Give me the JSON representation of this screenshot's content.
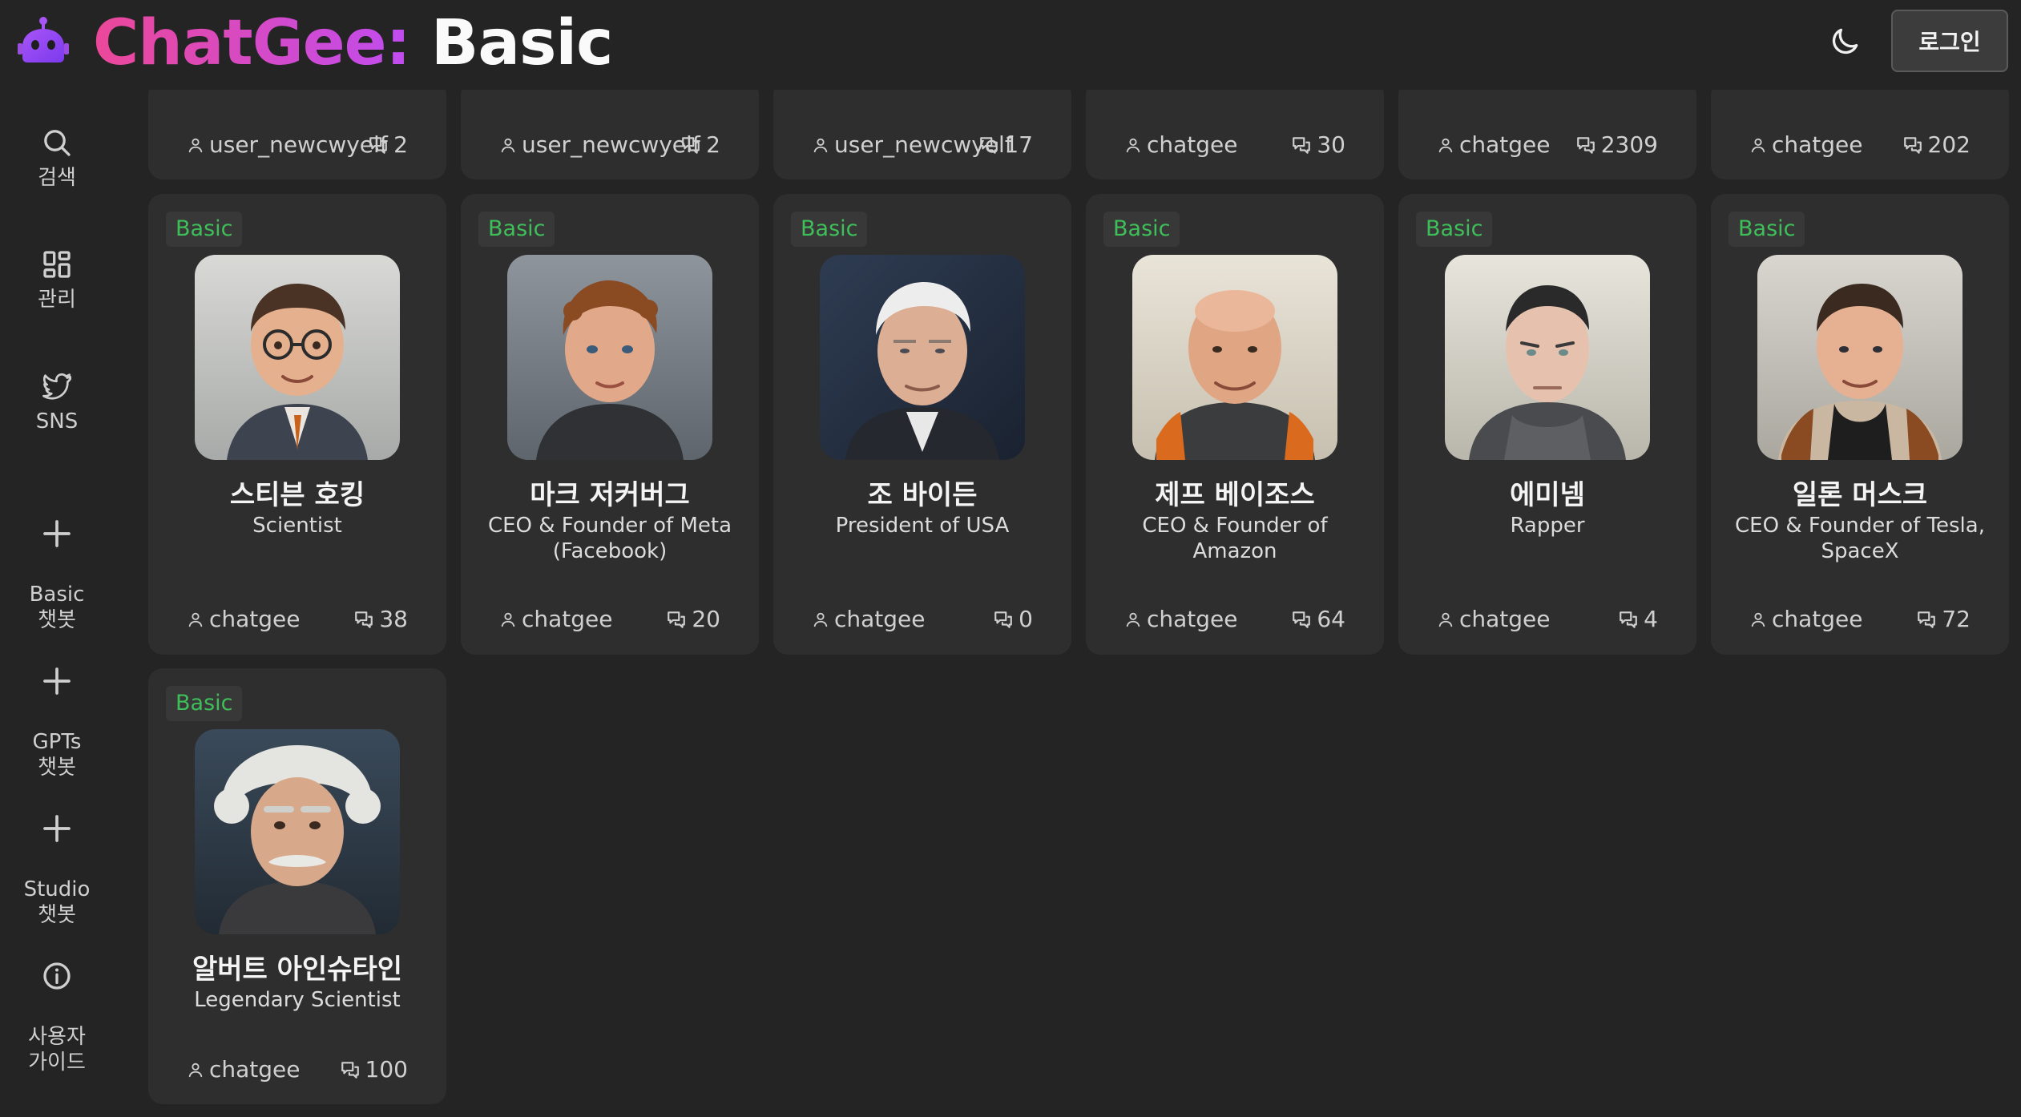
{
  "header": {
    "brand_prefix": "ChatGee:",
    "brand_suffix": "Basic",
    "login_label": "로그인"
  },
  "colors": {
    "background": "#242424",
    "card": "#2e2e2e",
    "badge_text": "#3fbf5a",
    "brand_gradient_start": "#ec4899",
    "brand_gradient_end": "#c04cf0"
  },
  "sidebar": {
    "items": [
      {
        "icon": "search-icon",
        "label": "검색"
      },
      {
        "icon": "grid-icon",
        "label": "관리"
      },
      {
        "icon": "twitter-bird-icon",
        "label": "SNS"
      },
      {
        "icon": "plus-icon",
        "label": "Basic\n챗봇"
      },
      {
        "icon": "plus-icon",
        "label": "GPTs\n챗봇"
      },
      {
        "icon": "plus-icon",
        "label": "Studio\n챗봇"
      },
      {
        "icon": "info-icon",
        "label": "사용자\n가이드"
      }
    ]
  },
  "top_row": [
    {
      "user": "user_newcwyelf",
      "count": "2"
    },
    {
      "user": "user_newcwyelf",
      "count": "2"
    },
    {
      "user": "user_newcwyelf",
      "count": "17"
    },
    {
      "user": "chatgee",
      "count": "30"
    },
    {
      "user": "chatgee",
      "count": "2309"
    },
    {
      "user": "chatgee",
      "count": "202"
    }
  ],
  "cards": [
    {
      "badge": "Basic",
      "name": "스티븐 호킹",
      "desc": "Scientist",
      "user": "chatgee",
      "count": "38",
      "avatar": "stephen-hawking"
    },
    {
      "badge": "Basic",
      "name": "마크 저커버그",
      "desc": "CEO & Founder of Meta (Facebook)",
      "user": "chatgee",
      "count": "20",
      "avatar": "mark-zuckerberg"
    },
    {
      "badge": "Basic",
      "name": "조 바이든",
      "desc": "President of USA",
      "user": "chatgee",
      "count": "0",
      "avatar": "joe-biden"
    },
    {
      "badge": "Basic",
      "name": "제프 베이조스",
      "desc": "CEO & Founder of Amazon",
      "user": "chatgee",
      "count": "64",
      "avatar": "jeff-bezos"
    },
    {
      "badge": "Basic",
      "name": "에미넴",
      "desc": "Rapper",
      "user": "chatgee",
      "count": "4",
      "avatar": "eminem"
    },
    {
      "badge": "Basic",
      "name": "일론 머스크",
      "desc": "CEO & Founder of Tesla, SpaceX",
      "user": "chatgee",
      "count": "72",
      "avatar": "elon-musk"
    },
    {
      "badge": "Basic",
      "name": "알버트 아인슈타인",
      "desc": "Legendary Scientist",
      "user": "chatgee",
      "count": "100",
      "avatar": "albert-einstein"
    }
  ]
}
